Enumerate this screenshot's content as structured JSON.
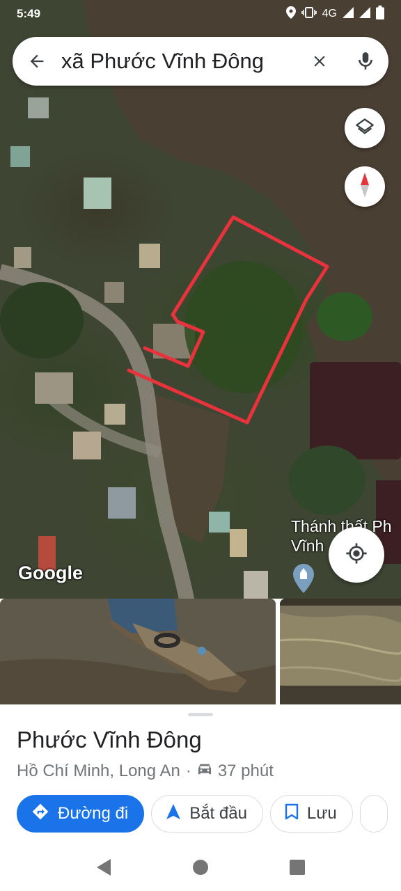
{
  "status_bar": {
    "time": "5:49",
    "network": "4G",
    "icons": [
      "location-icon",
      "vibrate-icon",
      "signal-icon",
      "signal-icon",
      "battery-icon"
    ]
  },
  "search": {
    "query": "xã Phước Vĩnh Đông",
    "back_icon": "arrow-back-icon",
    "clear_icon": "close-icon",
    "mic_icon": "mic-icon"
  },
  "map": {
    "layers_icon": "layers-icon",
    "compass_icon": "compass-icon",
    "locate_icon": "my-location-icon",
    "attribution": "Google",
    "poi_label_line1": "Thánh thất Ph",
    "poi_label_line2": "Vĩnh",
    "colors": {
      "boundary": "#e8323c",
      "river": "#4a3f33"
    }
  },
  "photos": [
    "photo-boat",
    "photo-water"
  ],
  "place": {
    "title": "Phước Vĩnh Đông",
    "region": "Hồ Chí Minh, Long An",
    "separator": "·",
    "travel_time": "37 phút",
    "car_icon": "car-icon"
  },
  "actions": {
    "directions": "Đường đi",
    "start": "Bắt đầu",
    "save": "Lưu"
  },
  "colors": {
    "accent": "#1a73e8",
    "text_primary": "#202124",
    "text_secondary": "#70757a"
  }
}
